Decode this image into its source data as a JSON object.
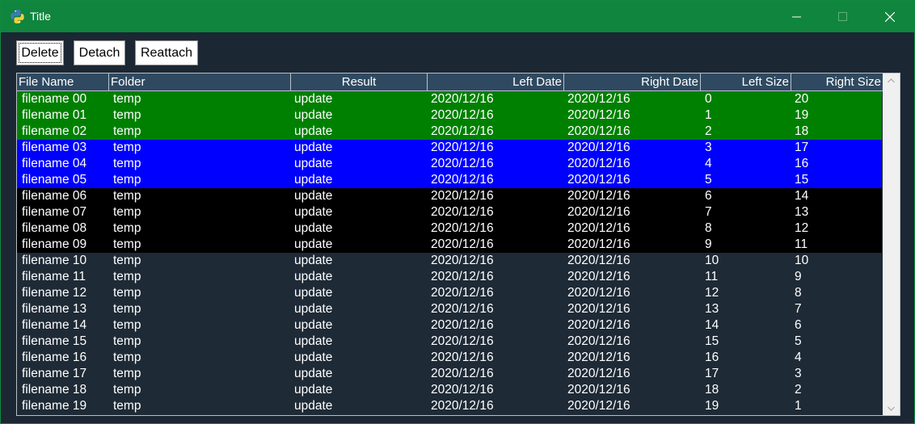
{
  "window": {
    "title": "Title"
  },
  "toolbar": {
    "delete_label": "Delete",
    "detach_label": "Detach",
    "reattach_label": "Reattach"
  },
  "table": {
    "columns": [
      "File Name",
      "Folder",
      "Result",
      "Left Date",
      "Right Date",
      "Left Size",
      "Right Size"
    ],
    "rows": [
      [
        "filename 00",
        "temp",
        "update",
        "2020/12/16",
        "2020/12/16",
        "0",
        "20"
      ],
      [
        "filename 01",
        "temp",
        "update",
        "2020/12/16",
        "2020/12/16",
        "1",
        "19"
      ],
      [
        "filename 02",
        "temp",
        "update",
        "2020/12/16",
        "2020/12/16",
        "2",
        "18"
      ],
      [
        "filename 03",
        "temp",
        "update",
        "2020/12/16",
        "2020/12/16",
        "3",
        "17"
      ],
      [
        "filename 04",
        "temp",
        "update",
        "2020/12/16",
        "2020/12/16",
        "4",
        "16"
      ],
      [
        "filename 05",
        "temp",
        "update",
        "2020/12/16",
        "2020/12/16",
        "5",
        "15"
      ],
      [
        "filename 06",
        "temp",
        "update",
        "2020/12/16",
        "2020/12/16",
        "6",
        "14"
      ],
      [
        "filename 07",
        "temp",
        "update",
        "2020/12/16",
        "2020/12/16",
        "7",
        "13"
      ],
      [
        "filename 08",
        "temp",
        "update",
        "2020/12/16",
        "2020/12/16",
        "8",
        "12"
      ],
      [
        "filename 09",
        "temp",
        "update",
        "2020/12/16",
        "2020/12/16",
        "9",
        "11"
      ],
      [
        "filename 10",
        "temp",
        "update",
        "2020/12/16",
        "2020/12/16",
        "10",
        "10"
      ],
      [
        "filename 11",
        "temp",
        "update",
        "2020/12/16",
        "2020/12/16",
        "11",
        "9"
      ],
      [
        "filename 12",
        "temp",
        "update",
        "2020/12/16",
        "2020/12/16",
        "12",
        "8"
      ],
      [
        "filename 13",
        "temp",
        "update",
        "2020/12/16",
        "2020/12/16",
        "13",
        "7"
      ],
      [
        "filename 14",
        "temp",
        "update",
        "2020/12/16",
        "2020/12/16",
        "14",
        "6"
      ],
      [
        "filename 15",
        "temp",
        "update",
        "2020/12/16",
        "2020/12/16",
        "15",
        "5"
      ],
      [
        "filename 16",
        "temp",
        "update",
        "2020/12/16",
        "2020/12/16",
        "16",
        "4"
      ],
      [
        "filename 17",
        "temp",
        "update",
        "2020/12/16",
        "2020/12/16",
        "17",
        "3"
      ],
      [
        "filename 18",
        "temp",
        "update",
        "2020/12/16",
        "2020/12/16",
        "18",
        "2"
      ],
      [
        "filename 19",
        "temp",
        "update",
        "2020/12/16",
        "2020/12/16",
        "19",
        "1"
      ]
    ],
    "row_colors": [
      "#008000",
      "#008000",
      "#008000",
      "#0000ff",
      "#0000ff",
      "#0000ff",
      "#000000",
      "#000000",
      "#000000",
      "#000000",
      "#1e2a36",
      "#1e2a36",
      "#1e2a36",
      "#1e2a36",
      "#1e2a36",
      "#1e2a36",
      "#1e2a36",
      "#1e2a36",
      "#1e2a36",
      "#1e2a36"
    ]
  },
  "icons": {
    "app": "python-logo-icon",
    "minimize": "minimize-icon",
    "maximize": "maximize-icon",
    "close": "close-icon",
    "scroll_up": "chevron-up-icon",
    "scroll_down": "chevron-down-icon"
  },
  "colors": {
    "titlebar": "#10853d",
    "window_bg": "#1b2733",
    "header_bg": "#2f4a60"
  }
}
